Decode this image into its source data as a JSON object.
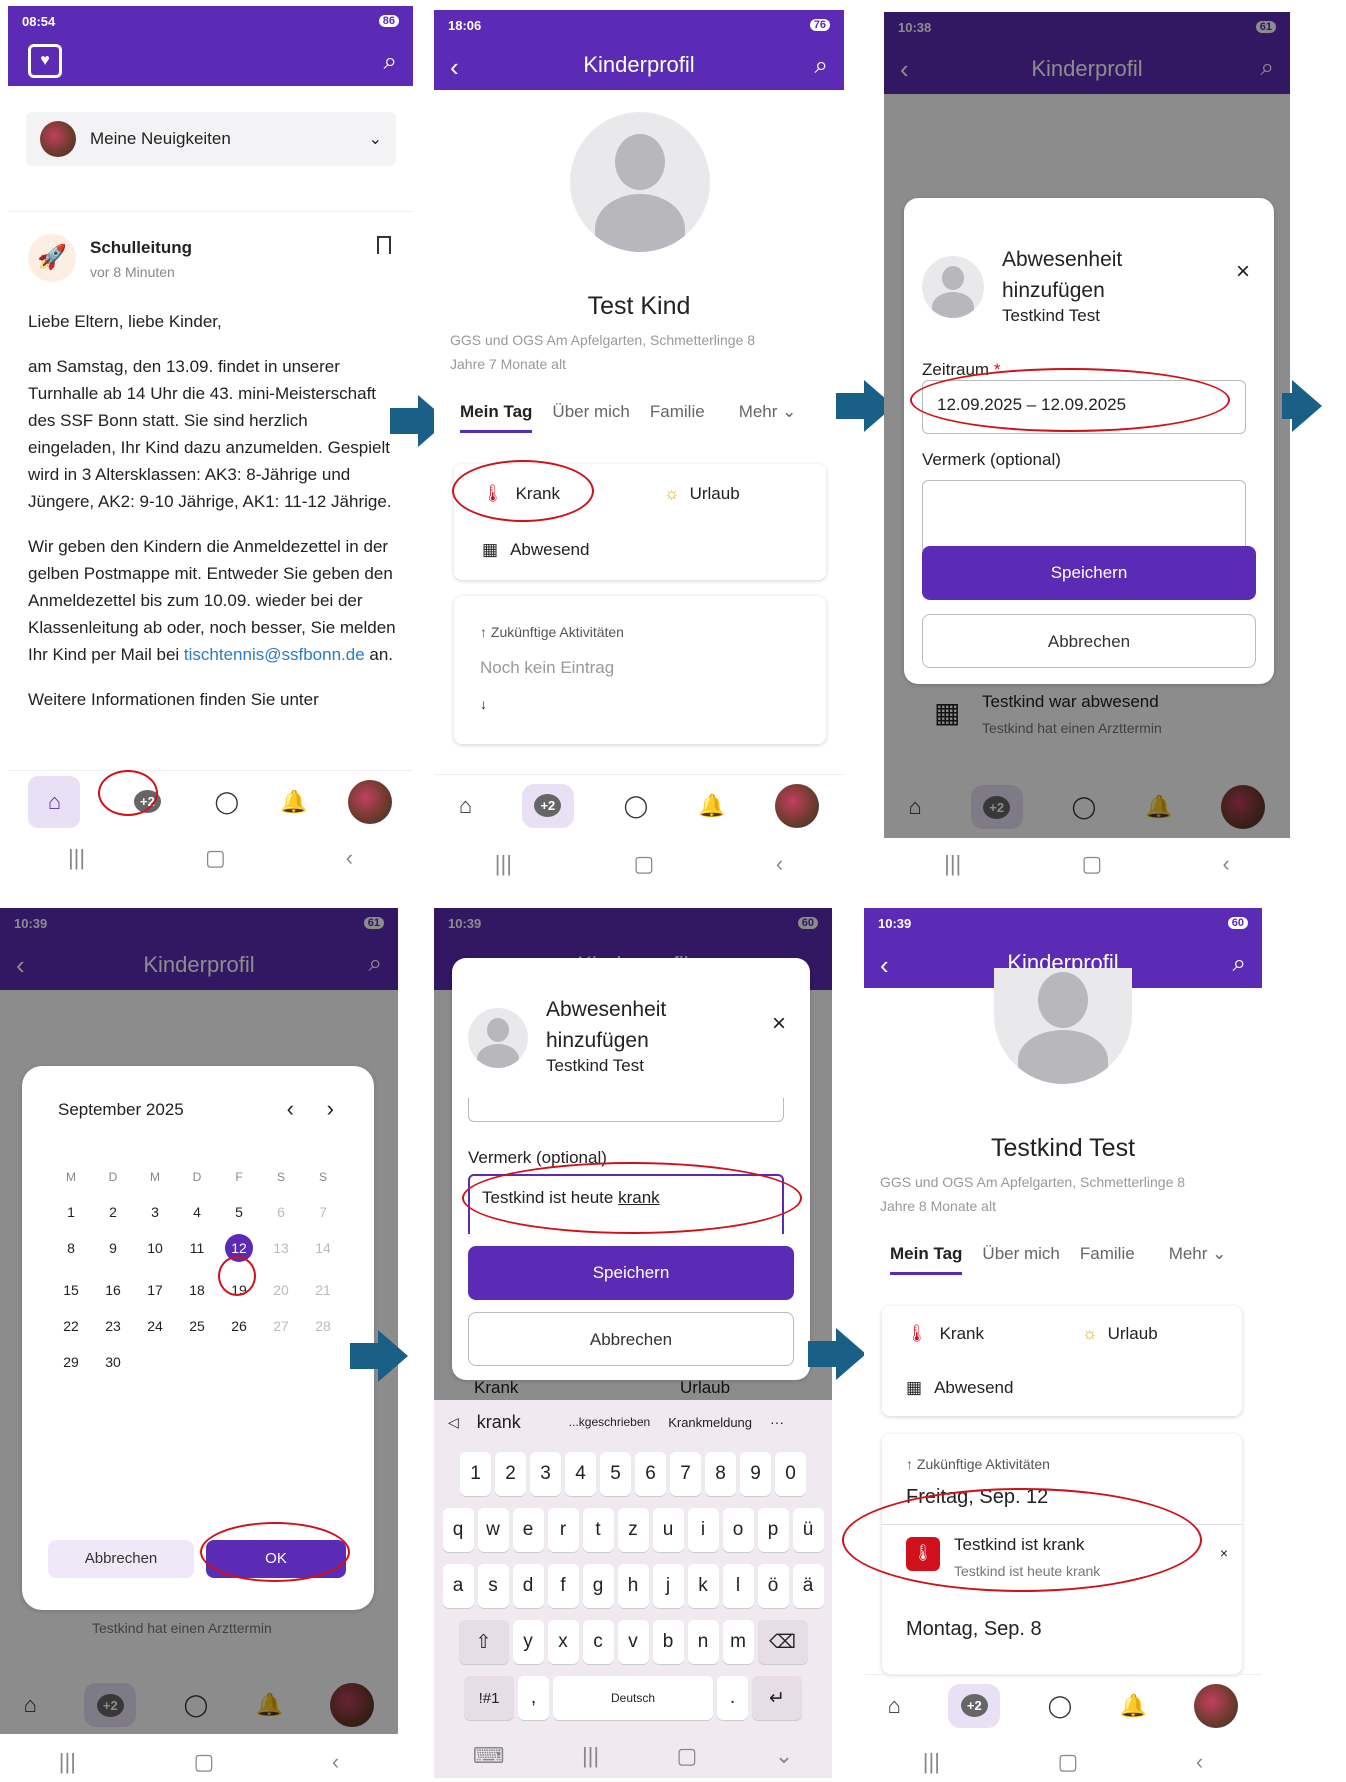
{
  "p1": {
    "time": "08:54",
    "battery": "86",
    "dropdown": "Meine Neuigkeiten",
    "author": "Schulleitung",
    "ago": "vor 8 Minuten",
    "p1": "Liebe Eltern, liebe Kinder,",
    "p2": "am Samstag, den 13.09. findet in unserer Turnhalle ab 14 Uhr die 43. mini-Meisterschaft des SSF Bonn statt. Sie sind herzlich eingeladen, Ihr Kind dazu anzumelden. Gespielt wird in 3 Altersklassen: AK3: 8-Jährige und Jüngere, AK2: 9-10 Jährige, AK1: 11-12 Jährige.",
    "p3a": "Wir geben den Kindern die Anmeldezettel in der gelben Postmappe mit. Entweder Sie geben den Anmeldezettel bis zum 10.09. wieder bei der Klassenleitung ab oder, noch besser, Sie melden Ihr Kind per Mail bei",
    "email": "tischtennis@ssfbonn.de",
    "p3b": " an.",
    "p4": "Weitere Informationen finden Sie unter",
    "grp": "+2"
  },
  "p2": {
    "time": "18:06",
    "battery": "76",
    "title": "Kinderprofil",
    "name": "Test Kind",
    "school": "GGS und OGS Am Apfelgarten, Schmetterlinge 8",
    "age": "Jahre 7 Monate alt",
    "tabs": [
      "Mein Tag",
      "Über mich",
      "Familie",
      "Mehr ⌄"
    ],
    "krank": "Krank",
    "urlaub": "Urlaub",
    "abwesend": "Abwesend",
    "future": "↑ Zukünftige Aktivitäten",
    "none": "Noch kein Eintrag",
    "down": "↓",
    "grp": "+2"
  },
  "p3": {
    "time": "10:38",
    "battery": "61",
    "title": "Kinderprofil",
    "modal_title": "Abwesenheit hinzufügen",
    "child": "Testkind Test",
    "zeitraum": "Zeitraum",
    "star": "*",
    "range": "12.09.2025 – 12.09.2025",
    "vermerk": "Vermerk (optional)",
    "save": "Speichern",
    "cancel": "Abbrechen",
    "bg_title": "Testkind war abwesend",
    "bg_sub": "Testkind hat einen Arzttermin",
    "grp": "+2"
  },
  "p4": {
    "time": "10:39",
    "battery": "61",
    "title": "Kinderprofil",
    "month": "September 2025",
    "wd": [
      "M",
      "D",
      "M",
      "D",
      "F",
      "S",
      "S"
    ],
    "weeks": [
      [
        "1",
        "2",
        "3",
        "4",
        "5",
        "6",
        "7"
      ],
      [
        "8",
        "9",
        "10",
        "11",
        "12",
        "13",
        "14"
      ],
      [
        "15",
        "16",
        "17",
        "18",
        "19",
        "20",
        "21"
      ],
      [
        "22",
        "23",
        "24",
        "25",
        "26",
        "27",
        "28"
      ],
      [
        "29",
        "30",
        "",
        "",
        "",
        "",
        ""
      ]
    ],
    "cancel": "Abbrechen",
    "ok": "OK",
    "bg_sub": "Testkind hat einen Arzttermin",
    "grp": "+2"
  },
  "p5": {
    "time": "10:39",
    "battery": "60",
    "title": "Kinderprofil",
    "modal_title": "Abwesenheit hinzufügen",
    "child": "Testkind Test",
    "vermerk": "Vermerk (optional)",
    "note_a": "Testkind ist heute ",
    "note_b": "krank",
    "save": "Speichern",
    "cancel": "Abbrechen",
    "bg_krank": "Krank",
    "bg_urlaub": "Urlaub",
    "suggest": [
      "krank",
      "...kgeschrieben",
      "Krankmeldung",
      "···"
    ],
    "row0": [
      "1",
      "2",
      "3",
      "4",
      "5",
      "6",
      "7",
      "8",
      "9",
      "0"
    ],
    "row1": [
      "q",
      "w",
      "e",
      "r",
      "t",
      "z",
      "u",
      "i",
      "o",
      "p",
      "ü"
    ],
    "row2": [
      "a",
      "s",
      "d",
      "f",
      "g",
      "h",
      "j",
      "k",
      "l",
      "ö",
      "ä"
    ],
    "row3": [
      "y",
      "x",
      "c",
      "v",
      "b",
      "n",
      "m"
    ],
    "sym": "!#1",
    "comma": ",",
    "space": "Deutsch",
    "dot": "."
  },
  "p6": {
    "time": "10:39",
    "battery": "60",
    "title": "Kinderprofil",
    "name": "Testkind Test",
    "school": "GGS und OGS Am Apfelgarten, Schmetterlinge 8",
    "age": "Jahre 8 Monate alt",
    "tabs": [
      "Mein Tag",
      "Über mich",
      "Familie",
      "Mehr ⌄"
    ],
    "krank": "Krank",
    "urlaub": "Urlaub",
    "abwesend": "Abwesend",
    "future": "↑ Zukünftige Aktivitäten",
    "day1": "Freitag, Sep. 12",
    "entry_title": "Testkind ist krank",
    "entry_sub": "Testkind ist heute krank",
    "x": "×",
    "day2": "Montag, Sep. 8",
    "grp": "+2"
  },
  "colors": {
    "brand": "#5b2bb5",
    "arrow": "#1a5f86",
    "highlight": "#d0101a"
  }
}
